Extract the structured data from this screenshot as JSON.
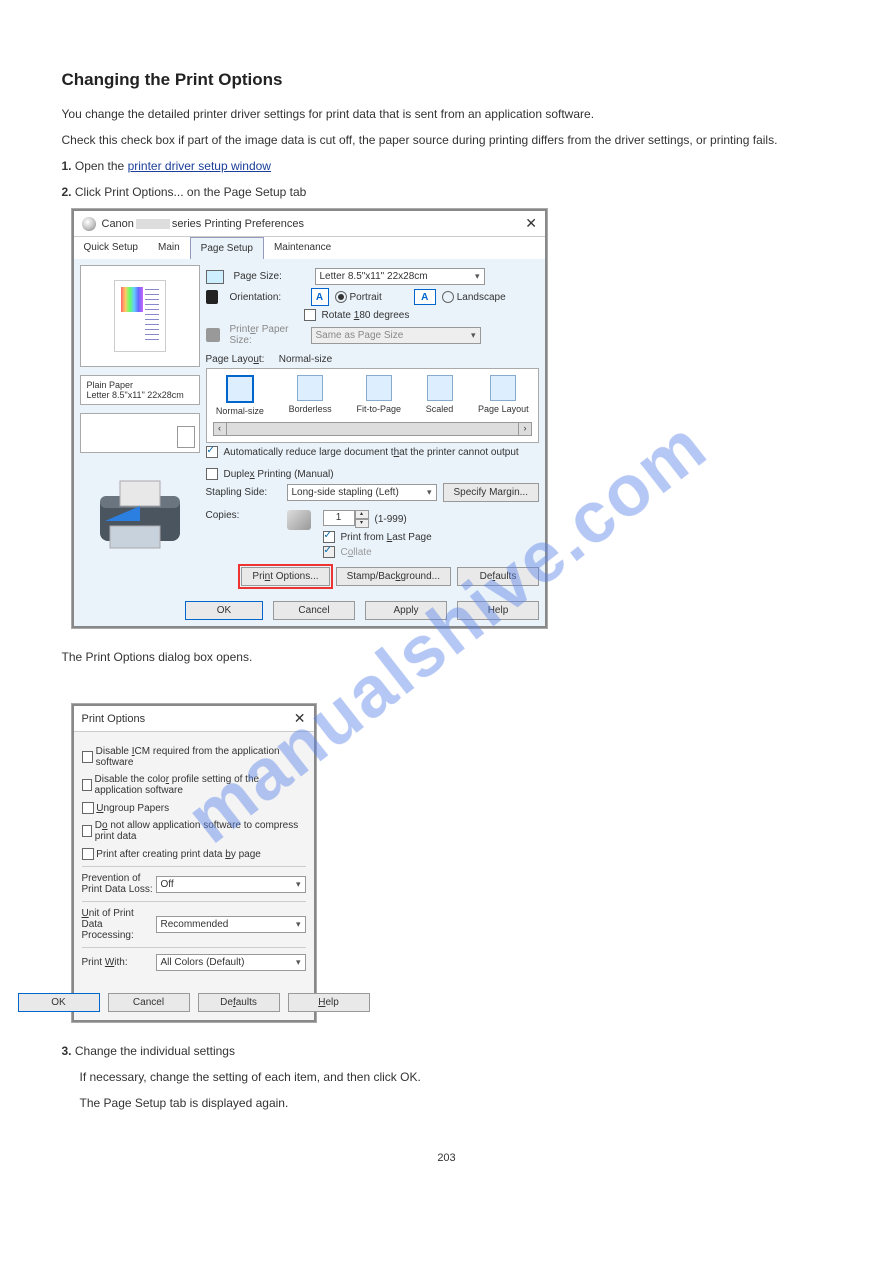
{
  "watermark": "manualshive.com",
  "doc": {
    "title": "Changing the Print Options",
    "p1": "You change the detailed printer driver settings for print data that is sent from an application software.",
    "p2": "Check this check box if part of the image data is cut off, the paper source during printing differs from the driver settings, or printing fails.",
    "step1_label": "1.",
    "step1_title": " Open the ",
    "step1_link": "printer driver setup window",
    "step2_label": "2.",
    "step2_text": " Click Print Options... on the Page Setup tab",
    "after_dialog": "The Print Options dialog box opens.",
    "step3_label": "3.",
    "step3_text": " Change the individual settings",
    "step3_body": "If necessary, change the setting of each item, and then click OK.",
    "footer": "The Page Setup tab is displayed again.",
    "pagenum": "203"
  },
  "main": {
    "title_prefix": "Canon ",
    "title_suffix": " series Printing Preferences",
    "tabs": {
      "quick": "Quick Setup",
      "main": "Main",
      "page": "Page Setup",
      "maint": "Maintenance"
    },
    "preview": {
      "media": "Plain Paper",
      "size": "Letter 8.5\"x11\" 22x28cm"
    },
    "page_size_lbl": "Page Size:",
    "page_size_val": "Letter 8.5\"x11\" 22x28cm",
    "orient_lbl": "Orientation:",
    "portrait": "Portrait",
    "landscape": "Landscape",
    "rotate": "Rotate 180 degrees",
    "printer_paper_lbl": "Printer Paper Size:",
    "printer_paper_val": "Same as Page Size",
    "layout_lbl": "Page Layout:",
    "layout_val": "Normal-size",
    "lay": {
      "n": "Normal-size",
      "b": "Borderless",
      "f": "Fit-to-Page",
      "s": "Scaled",
      "p": "Page Layout"
    },
    "auto_reduce": "Automatically reduce large document that the printer cannot output",
    "duplex": "Duplex Printing (Manual)",
    "stapling_lbl": "Stapling Side:",
    "stapling_val": "Long-side stapling (Left)",
    "specify_margin": "Specify Margin...",
    "copies_lbl": "Copies:",
    "copies_val": "1",
    "copies_range": "(1-999)",
    "print_last": "Print from Last Page",
    "collate": "Collate",
    "print_options": "Print Options...",
    "stamp_bg": "Stamp/Background...",
    "defaults": "Defaults",
    "ok": "OK",
    "cancel": "Cancel",
    "apply": "Apply",
    "help": "Help"
  },
  "po": {
    "title": "Print Options",
    "c1": "Disable ICM required from the application software",
    "c2": "Disable the color profile setting of the application software",
    "c3": "Ungroup Papers",
    "c4": "Do not allow application software to compress print data",
    "c5": "Print after creating print data by page",
    "prevention_lbl": "Prevention of Print Data Loss:",
    "prevention_val": "Off",
    "unit_lbl": "Unit of Print Data Processing:",
    "unit_val": "Recommended",
    "pw_lbl": "Print With:",
    "pw_val": "All Colors (Default)",
    "ok": "OK",
    "cancel": "Cancel",
    "defaults": "Defaults",
    "help": "Help"
  }
}
